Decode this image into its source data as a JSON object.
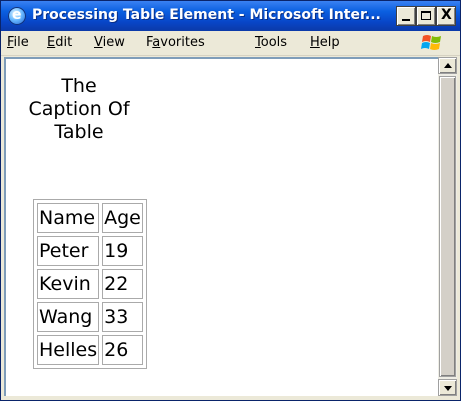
{
  "window": {
    "title": "Processing Table Element - Microsoft Inter...",
    "close_glyph": "X"
  },
  "menu": {
    "items": [
      {
        "underline": "F",
        "rest": "ile"
      },
      {
        "underline": "E",
        "rest": "dit"
      },
      {
        "underline": "V",
        "rest": "iew"
      },
      {
        "pre": "F",
        "underline": "a",
        "rest": "vorites"
      },
      {
        "underline": "T",
        "rest": "ools"
      },
      {
        "underline": "H",
        "rest": "elp"
      }
    ]
  },
  "page": {
    "caption_lines": [
      "The",
      "Caption Of",
      "Table"
    ],
    "table": {
      "headers": [
        "Name",
        "Age"
      ],
      "rows": [
        [
          "Peter",
          "19"
        ],
        [
          "Kevin",
          "22"
        ],
        [
          "Wang",
          "33"
        ],
        [
          "Helles",
          "26"
        ]
      ]
    }
  },
  "colors": {
    "titlebar": "#0846c8",
    "chrome": "#ece9d8",
    "content_bg": "#ffffff",
    "cell_border": "#aaaaaa"
  },
  "icons": {
    "app": "ie-logo-icon",
    "brand": "windows-flag-icon"
  }
}
